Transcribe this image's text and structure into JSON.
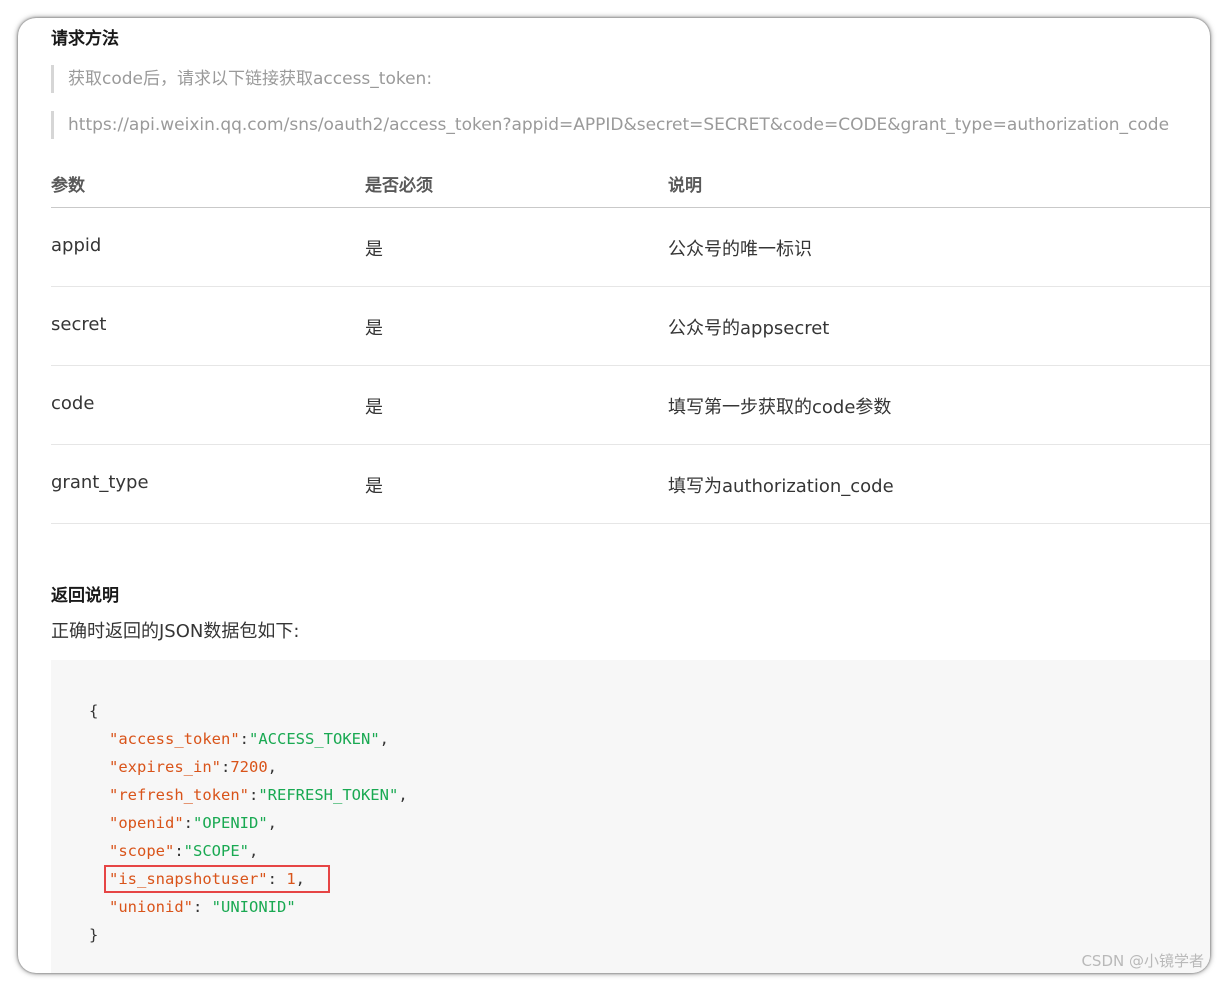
{
  "section_title": "请求方法",
  "intro_note": "获取code后，请求以下链接获取access_token:",
  "request_url": "https://api.weixin.qq.com/sns/oauth2/access_token?appid=APPID&secret=SECRET&code=CODE&grant_type=authorization_code",
  "params_table": {
    "headers": [
      "参数",
      "是否必须",
      "说明"
    ],
    "rows": [
      {
        "param": "appid",
        "required": "是",
        "desc": "公众号的唯一标识"
      },
      {
        "param": "secret",
        "required": "是",
        "desc": "公众号的appsecret"
      },
      {
        "param": "code",
        "required": "是",
        "desc": "填写第一步获取的code参数"
      },
      {
        "param": "grant_type",
        "required": "是",
        "desc": "填写为authorization_code"
      }
    ]
  },
  "return_title": "返回说明",
  "return_desc": "正确时返回的JSON数据包如下:",
  "json_example": {
    "open_brace": "{",
    "close_brace": "}",
    "lines": [
      {
        "key": "\"access_token\"",
        "sep": ":",
        "value": "\"ACCESS_TOKEN\"",
        "value_type": "string",
        "end": ","
      },
      {
        "key": "\"expires_in\"",
        "sep": ":",
        "value": "7200",
        "value_type": "number",
        "end": ","
      },
      {
        "key": "\"refresh_token\"",
        "sep": ":",
        "value": "\"REFRESH_TOKEN\"",
        "value_type": "string",
        "end": ","
      },
      {
        "key": "\"openid\"",
        "sep": ":",
        "value": "\"OPENID\"",
        "value_type": "string",
        "end": ","
      },
      {
        "key": "\"scope\"",
        "sep": ":",
        "value": "\"SCOPE\"",
        "value_type": "string",
        "end": ","
      },
      {
        "key": "\"is_snapshotuser\"",
        "sep": ": ",
        "value": "1",
        "value_type": "number",
        "end": ","
      },
      {
        "key": "\"unionid\"",
        "sep": ": ",
        "value": "\"UNIONID\"",
        "value_type": "string",
        "end": ""
      }
    ],
    "highlighted_key": "is_snapshotuser"
  },
  "watermark": "CSDN @小镜学者",
  "colors": {
    "key": "#d9541a",
    "string": "#19a952",
    "highlight_border": "#e64545"
  }
}
